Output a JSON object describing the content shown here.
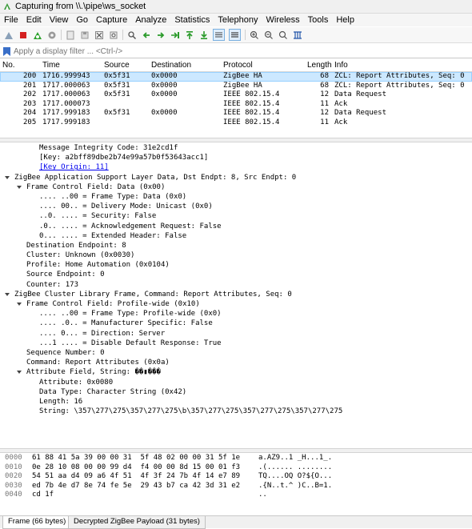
{
  "window": {
    "title": "Capturing from \\\\.\\pipe\\ws_socket"
  },
  "menu": [
    "File",
    "Edit",
    "View",
    "Go",
    "Capture",
    "Analyze",
    "Statistics",
    "Telephony",
    "Wireless",
    "Tools",
    "Help"
  ],
  "toolbar_icons": [
    "shark-fin-icon",
    "stop-icon",
    "restart-icon",
    "options-gear-icon",
    "open-file-icon",
    "save-file-icon",
    "close-file-icon",
    "reload-icon",
    "find-icon",
    "back-arrow-icon",
    "forward-arrow-icon",
    "go-to-packet-icon",
    "go-first-icon",
    "go-last-icon",
    "autoscroll-icon",
    "colorize-icon",
    "zoom-in-icon",
    "zoom-out-icon",
    "zoom-normal-icon",
    "resize-columns-icon"
  ],
  "filter": {
    "placeholder": "Apply a display filter ... <Ctrl-/>"
  },
  "packet_list": {
    "columns": [
      "No.",
      "Time",
      "Source",
      "Destination",
      "Protocol",
      "Length",
      "Info"
    ],
    "rows": [
      {
        "no": "200",
        "time": "1716.999943",
        "src": "0x5f31",
        "dst": "0x0000",
        "proto": "ZigBee HA",
        "len": "68",
        "info": "ZCL: Report Attributes, Seq: 0",
        "selected": true
      },
      {
        "no": "201",
        "time": "1717.000063",
        "src": "0x5f31",
        "dst": "0x0000",
        "proto": "ZigBee HA",
        "len": "68",
        "info": "ZCL: Report Attributes, Seq: 0",
        "selected": false
      },
      {
        "no": "202",
        "time": "1717.000063",
        "src": "0x5f31",
        "dst": "0x0000",
        "proto": "IEEE 802.15.4",
        "len": "12",
        "info": "Data Request",
        "selected": false
      },
      {
        "no": "203",
        "time": "1717.000073",
        "src": "",
        "dst": "",
        "proto": "IEEE 802.15.4",
        "len": "11",
        "info": "Ack",
        "selected": false
      },
      {
        "no": "204",
        "time": "1717.999183",
        "src": "0x5f31",
        "dst": "0x0000",
        "proto": "IEEE 802.15.4",
        "len": "12",
        "info": "Data Request",
        "selected": false
      },
      {
        "no": "205",
        "time": "1717.999183",
        "src": "",
        "dst": "",
        "proto": "IEEE 802.15.4",
        "len": "11",
        "info": "Ack",
        "selected": false
      }
    ]
  },
  "details": [
    {
      "indent": 3,
      "text": "Message Integrity Code: 31e2cd1f",
      "expand": ""
    },
    {
      "indent": 3,
      "text": "[Key: a2bff89dbe2b74e99a57b0f53643acc1]",
      "expand": ""
    },
    {
      "indent": 3,
      "text": "[Key Origin: 11]",
      "expand": "",
      "link": true
    },
    {
      "indent": 0,
      "text": "ZigBee Application Support Layer Data, Dst Endpt: 8, Src Endpt: 0",
      "expand": "open"
    },
    {
      "indent": 1,
      "text": "Frame Control Field: Data (0x00)",
      "expand": "open"
    },
    {
      "indent": 3,
      "text": ".... ..00 = Frame Type: Data (0x0)",
      "expand": ""
    },
    {
      "indent": 3,
      "text": ".... 00.. = Delivery Mode: Unicast (0x0)",
      "expand": ""
    },
    {
      "indent": 3,
      "text": "..0. .... = Security: False",
      "expand": ""
    },
    {
      "indent": 3,
      "text": ".0.. .... = Acknowledgement Request: False",
      "expand": ""
    },
    {
      "indent": 3,
      "text": "0... .... = Extended Header: False",
      "expand": ""
    },
    {
      "indent": 2,
      "text": "Destination Endpoint: 8",
      "expand": ""
    },
    {
      "indent": 2,
      "text": "Cluster: Unknown (0x0030)",
      "expand": ""
    },
    {
      "indent": 2,
      "text": "Profile: Home Automation (0x0104)",
      "expand": ""
    },
    {
      "indent": 2,
      "text": "Source Endpoint: 0",
      "expand": ""
    },
    {
      "indent": 2,
      "text": "Counter: 173",
      "expand": ""
    },
    {
      "indent": 0,
      "text": "ZigBee Cluster Library Frame, Command: Report Attributes, Seq: 0",
      "expand": "open"
    },
    {
      "indent": 1,
      "text": "Frame Control Field: Profile-wide (0x10)",
      "expand": "open"
    },
    {
      "indent": 3,
      "text": ".... ..00 = Frame Type: Profile-wide (0x0)",
      "expand": ""
    },
    {
      "indent": 3,
      "text": ".... .0.. = Manufacturer Specific: False",
      "expand": ""
    },
    {
      "indent": 3,
      "text": ".... 0... = Direction: Server",
      "expand": ""
    },
    {
      "indent": 3,
      "text": "...1 .... = Disable Default Response: True",
      "expand": ""
    },
    {
      "indent": 2,
      "text": "Sequence Number: 0",
      "expand": ""
    },
    {
      "indent": 2,
      "text": "Command: Report Attributes (0x0a)",
      "expand": ""
    },
    {
      "indent": 1,
      "text": "Attribute Field, String: ��▮���",
      "expand": "open"
    },
    {
      "indent": 3,
      "text": "Attribute: 0x0080",
      "expand": ""
    },
    {
      "indent": 3,
      "text": "Data Type: Character String (0x42)",
      "expand": ""
    },
    {
      "indent": 3,
      "text": "Length: 16",
      "expand": ""
    },
    {
      "indent": 3,
      "text": "String: \\357\\277\\275\\357\\277\\275\\b\\357\\277\\275\\357\\277\\275\\357\\277\\275",
      "expand": ""
    }
  ],
  "hex_dump": [
    {
      "offset": "0000",
      "bytes": "61 88 41 5a 39 00 00 31  5f 48 02 00 00 31 5f 1e",
      "ascii": "a.AZ9..1 _H...1_."
    },
    {
      "offset": "0010",
      "bytes": "0e 28 10 08 00 00 99 d4  f4 00 00 8d 15 00 01 f3",
      "ascii": ".(...... ........"
    },
    {
      "offset": "0020",
      "bytes": "54 51 aa d4 09 a6 4f 51  4f 3f 24 7b 4f 14 e7 89",
      "ascii": "TQ....OQ O?${O..."
    },
    {
      "offset": "0030",
      "bytes": "ed 7b 4e d7 8e 74 fe 5e  29 43 b7 ca 42 3d 31 e2",
      "ascii": ".{N..t.^ )C..B=1."
    },
    {
      "offset": "0040",
      "bytes": "cd 1f",
      "ascii": ".."
    }
  ],
  "bottom_tabs": [
    "Frame (66 bytes)",
    "Decrypted ZigBee Payload (31 bytes)"
  ],
  "colors": {
    "selection": "#cce8ff",
    "link": "#0000ee"
  }
}
